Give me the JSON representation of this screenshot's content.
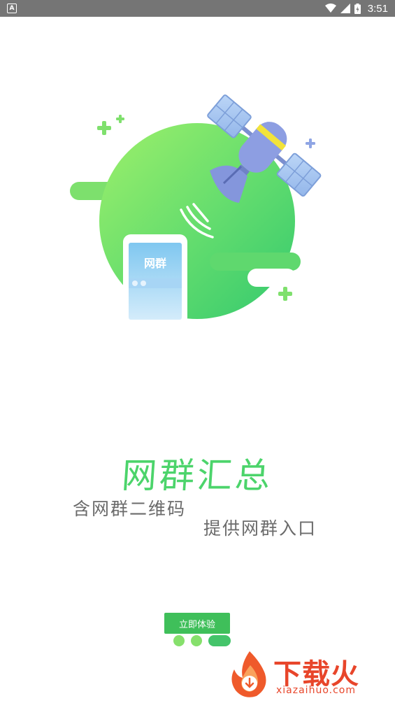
{
  "status_bar": {
    "notification_icon": "A",
    "time": "3:51",
    "icons": [
      "wifi-icon",
      "signal-icon",
      "battery-icon"
    ]
  },
  "illustration": {
    "phone_label": "网群"
  },
  "headline": "网群汇总",
  "slogans": {
    "line1": "含网群二维码",
    "line2": "提供网群入口"
  },
  "button": {
    "label": "立即体验"
  },
  "pager": {
    "count": 3,
    "active_index": 2
  },
  "watermark": {
    "title": "下载火",
    "site": "xiazaihuo.com"
  },
  "colors": {
    "accent_green": "#4cd46b",
    "button_green": "#3fbf5a",
    "status_bar": "#757575",
    "watermark": "#e8452a"
  }
}
